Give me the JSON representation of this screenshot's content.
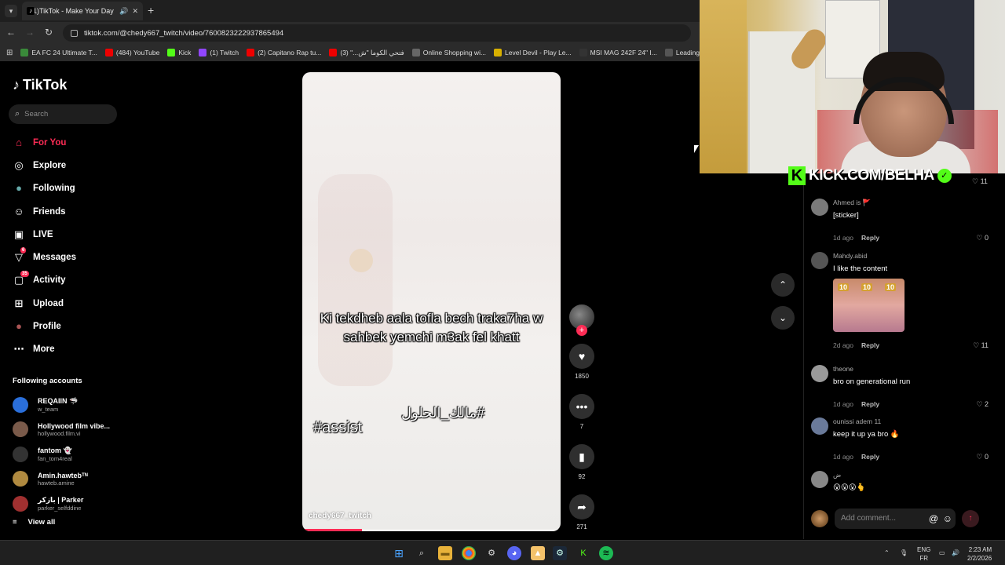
{
  "browser": {
    "tab_title": "(21)TikTok - Make Your Day",
    "url": "tiktok.com/@chedy667_twitch/video/7600823222937865494",
    "bookmarks": [
      {
        "label": "EA FC 24 Ultimate T...",
        "color": "#3a8a3a"
      },
      {
        "label": "(484) YouTube",
        "color": "#e00"
      },
      {
        "label": "Kick",
        "color": "#53fc18"
      },
      {
        "label": "(1) Twitch",
        "color": "#9146ff"
      },
      {
        "label": "(2) Capitano Rap tu...",
        "color": "#e00"
      },
      {
        "label": "فتحي الكوما \"ش...\" (3)",
        "color": "#e00"
      },
      {
        "label": "Online Shopping wi...",
        "color": "#666"
      },
      {
        "label": "Level Devil - Play Le...",
        "color": "#d8b000"
      },
      {
        "label": "MSI MAG 242F 24\" I...",
        "color": "#333"
      },
      {
        "label": "Leading Digit",
        "color": "#555"
      }
    ]
  },
  "sidebar": {
    "logo": "TikTok",
    "search_placeholder": "Search",
    "nav": [
      {
        "label": "For You",
        "icon": "home-icon",
        "glyph": "⌂",
        "active": true
      },
      {
        "label": "Explore",
        "icon": "compass-icon",
        "glyph": "◎"
      },
      {
        "label": "Following",
        "icon": "following-avatar-icon",
        "glyph": "●"
      },
      {
        "label": "Friends",
        "icon": "friends-icon",
        "glyph": "☺"
      },
      {
        "label": "LIVE",
        "icon": "live-icon",
        "glyph": "▣"
      },
      {
        "label": "Messages",
        "icon": "messages-icon",
        "glyph": "▽",
        "badge": "6"
      },
      {
        "label": "Activity",
        "icon": "activity-icon",
        "glyph": "▢",
        "badge": "35"
      },
      {
        "label": "Upload",
        "icon": "upload-icon",
        "glyph": "⊞"
      },
      {
        "label": "Profile",
        "icon": "profile-avatar-icon",
        "glyph": "●"
      },
      {
        "label": "More",
        "icon": "more-icon",
        "glyph": "⋯"
      }
    ],
    "following_header": "Following accounts",
    "accounts": [
      {
        "name": "REQAIIN 🦈",
        "handle": "w_team",
        "color": "#2a6fdb"
      },
      {
        "name": "Hollywood film vibe...",
        "handle": "hollywood.film.vi",
        "color": "#7a5a4a"
      },
      {
        "name": "fantom 👻",
        "handle": "fan_tom4real",
        "color": "#333"
      },
      {
        "name": "Amin.hawtebᵀᴺ",
        "handle": "hawteb.amine",
        "color": "#b08a40"
      },
      {
        "name": "بازكر | Parker",
        "handle": "parker_selfddine",
        "color": "#a03030"
      }
    ],
    "view_all": "View all"
  },
  "video": {
    "caption": "Ki tekdheb aala tofla bech traka7ha w sahbek yemchi m3ak fel khatt",
    "tag_left": "#assist",
    "tag_right": "#مالك_الحلول",
    "author": "chedy667_twitch",
    "progress": 0.23
  },
  "actions": {
    "likes": "1850",
    "comments": "7",
    "saves": "92",
    "shares": "271"
  },
  "comments": {
    "top_like_count": "11",
    "items": [
      {
        "user": "Ahmed is 🚩",
        "text": "[sticker]",
        "time": "1d ago",
        "reply": "Reply",
        "likes": "0",
        "avatar": "#7a7a7a"
      },
      {
        "user": "Mahdy.abid",
        "text": "I like the content",
        "time": "2d ago",
        "reply": "Reply",
        "likes": "11",
        "avatar": "#555",
        "sticker_labels": [
          "10",
          "10",
          "10"
        ]
      },
      {
        "user": "theone",
        "text": "bro on generational run",
        "time": "1d ago",
        "reply": "Reply",
        "likes": "2",
        "avatar": "#999"
      },
      {
        "user": "ounissi adem 11",
        "text": "keep it up ya bro 🔥",
        "time": "1d ago",
        "reply": "Reply",
        "likes": "0",
        "avatar": "#6a7a9a"
      },
      {
        "user": "ض",
        "text": "😮😮😮🫰",
        "time": "",
        "reply": "",
        "likes": "",
        "avatar": "#888"
      }
    ],
    "add_placeholder": "Add comment...",
    "at_symbol": "@"
  },
  "webcam": {
    "kick_text": "KICK.COM/BELHA"
  },
  "taskbar": {
    "lang_top": "ENG",
    "lang_bottom": "FR",
    "time": "2:23 AM",
    "date": "2/2/2026"
  }
}
